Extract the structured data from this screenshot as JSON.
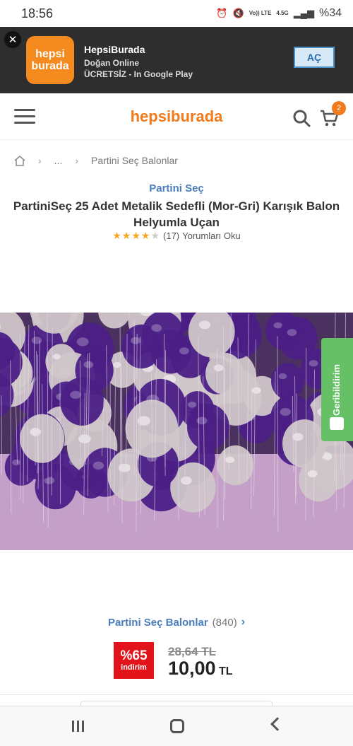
{
  "status_bar": {
    "time": "18:56",
    "network_label": "Vo)) LTE",
    "network_speed": "4.5G",
    "battery": "%34"
  },
  "app_banner": {
    "logo_line1": "hepsi",
    "logo_line2": "burada",
    "title": "HepsiBurada",
    "publisher": "Doğan Online",
    "subtitle": "ÜCRETSİZ - In Google Play",
    "open_label": "AÇ",
    "close_glyph": "✕"
  },
  "header": {
    "logo_text": "hepsiburada",
    "cart_count": "2",
    "accent_color": "#f27a1a"
  },
  "breadcrumb": {
    "ellipsis": "...",
    "current": "Partini Seç Balonlar"
  },
  "product": {
    "brand": "Partini Seç",
    "title": "PartiniSeç 25 Adet Metalik Sedefli (Mor-Gri) Karışık Balon Helyumla Uçan",
    "rating_stars": 4,
    "review_count": "(17)",
    "reviews_link": "Yorumları Oku"
  },
  "feedback_tab": {
    "label": "Geribildirim",
    "color": "#66c166"
  },
  "store": {
    "name": "Partini Seç Balonlar",
    "count": "(840)",
    "chevron": "›"
  },
  "price": {
    "discount_pct": "%65",
    "discount_label": "indirim",
    "old_price": "28,64 TL",
    "new_price": "10,00",
    "currency": "TL",
    "discount_color": "#e3131b"
  }
}
